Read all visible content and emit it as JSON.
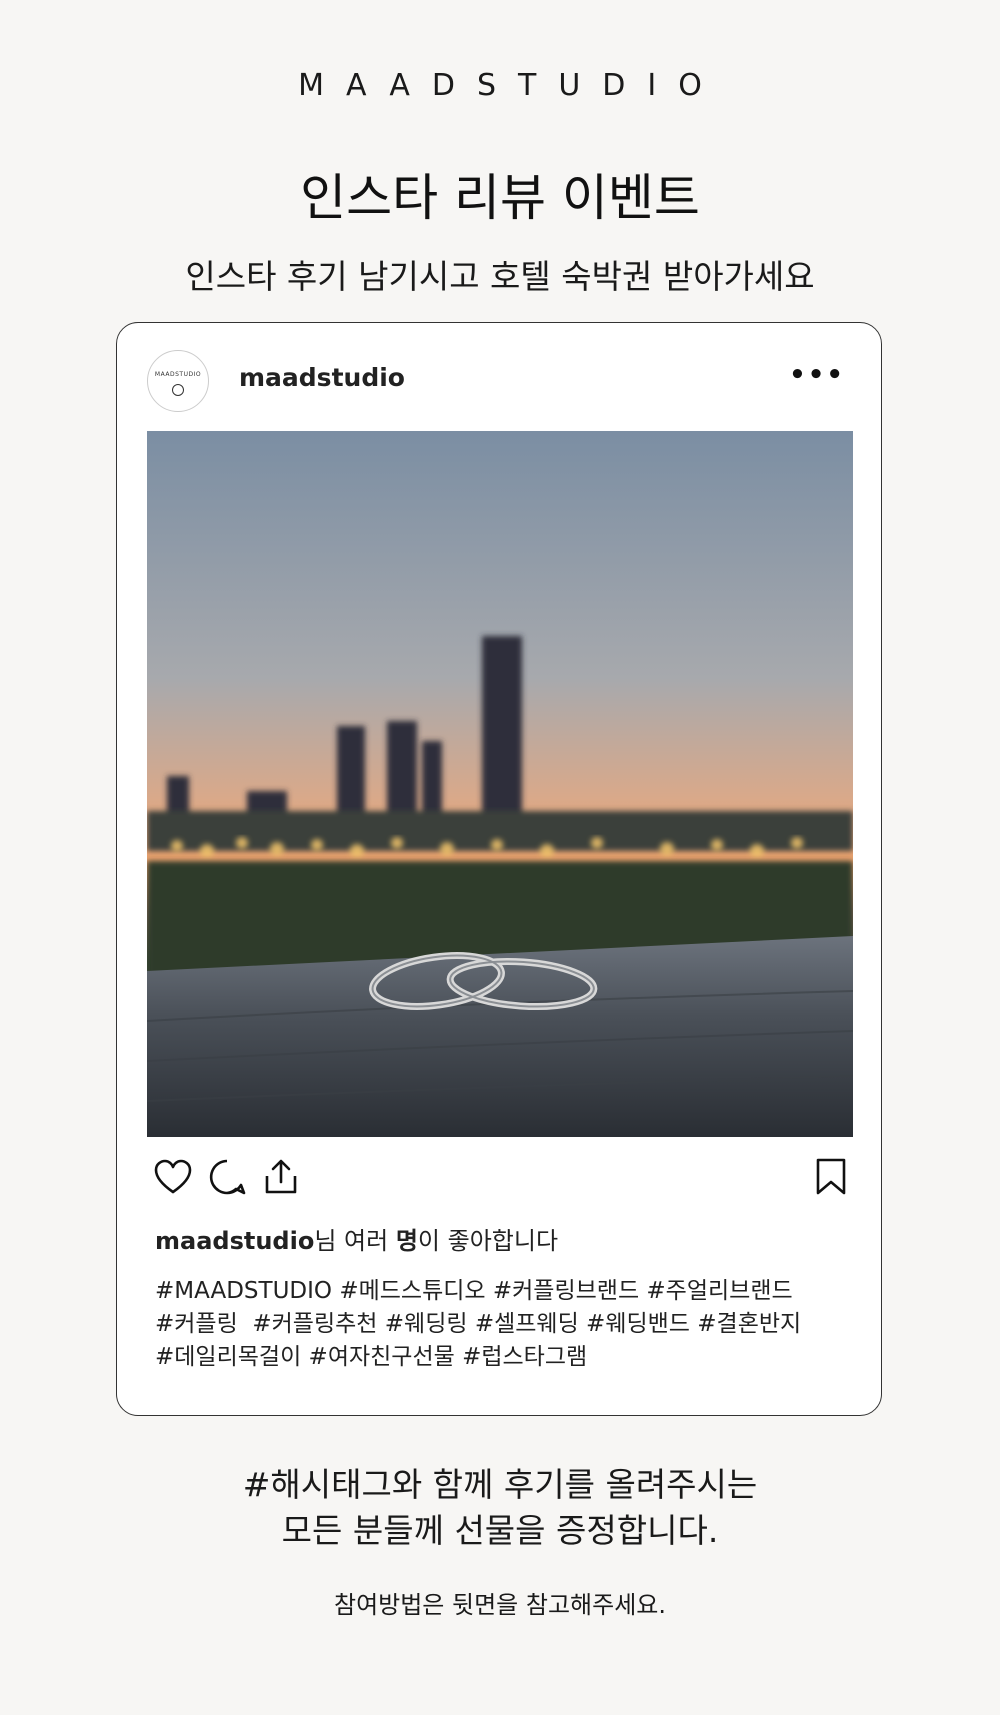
{
  "brand": "MAADSTUDIO",
  "header": {
    "title": "인스타 리뷰 이벤트",
    "subtitle": "인스타 후기 남기시고 호텔 숙박권 받아가세요"
  },
  "post": {
    "avatar_text": "MAADSTUDIO",
    "username": "maadstudio",
    "more_label": "•••",
    "likes_user": "maadstudio",
    "likes_mid": "님 여러 ",
    "likes_bold": "명",
    "likes_end": "이 좋아합니다",
    "hashtag_lines": [
      "#MAADSTUDIO #메드스튜디오 #커플링브랜드 #주얼리브랜드",
      "#커플링  #커플링추천 #웨딩링 #셀프웨딩 #웨딩밴드 #결혼반지",
      "#데일리목걸이 #여자친구선물 #럽스타그램"
    ],
    "icons": [
      "heart-icon",
      "comment-icon",
      "share-icon",
      "bookmark-icon",
      "more-icon"
    ]
  },
  "footer": {
    "cta_line1": "#해시태그와 함께 후기를 올려주시는",
    "cta_line2": "모든 분들께 선물을 증정합니다.",
    "note": "참여방법은 뒷면을 참고해주세요."
  },
  "colors": {
    "background": "#f7f6f4",
    "card_border": "#333333",
    "text": "#111111"
  }
}
